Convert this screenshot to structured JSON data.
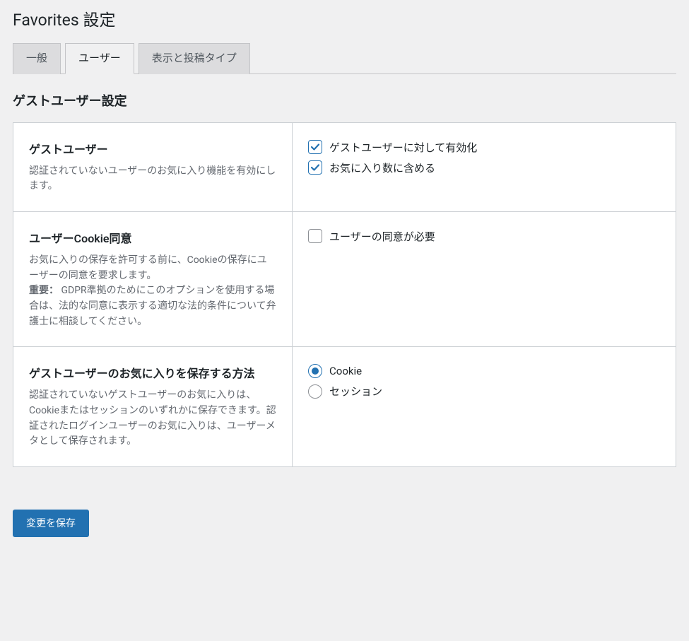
{
  "page_title": "Favorites 設定",
  "tabs": [
    {
      "label": "一般",
      "active": false
    },
    {
      "label": "ユーザー",
      "active": true
    },
    {
      "label": "表示と投稿タイプ",
      "active": false
    }
  ],
  "section_title": "ゲストユーザー設定",
  "rows": {
    "guest_user": {
      "title": "ゲストユーザー",
      "desc": "認証されていないユーザーのお気に入り機能を有効にします。",
      "options": {
        "enable": {
          "label": "ゲストユーザーに対して有効化",
          "checked": true
        },
        "include_count": {
          "label": "お気に入り数に含める",
          "checked": true
        }
      }
    },
    "cookie_consent": {
      "title": "ユーザーCookie同意",
      "desc_pre": "お気に入りの保存を許可する前に、Cookieの保存にユーザーの同意を要求します。",
      "important_label": "重要：",
      "desc_post": " GDPR準拠のためにこのオプションを使用する場合は、法的な同意に表示する適切な法的条件について弁護士に相談してください。",
      "options": {
        "require_consent": {
          "label": "ユーザーの同意が必要",
          "checked": false
        }
      }
    },
    "save_method": {
      "title": "ゲストユーザーのお気に入りを保存する方法",
      "desc": "認証されていないゲストユーザーのお気に入りは、Cookieまたはセッションのいずれかに保存できます。認証されたログインユーザーのお気に入りは、ユーザーメタとして保存されます。",
      "options": {
        "cookie": {
          "label": "Cookie",
          "selected": true
        },
        "session": {
          "label": "セッション",
          "selected": false
        }
      }
    }
  },
  "save_button": "変更を保存"
}
